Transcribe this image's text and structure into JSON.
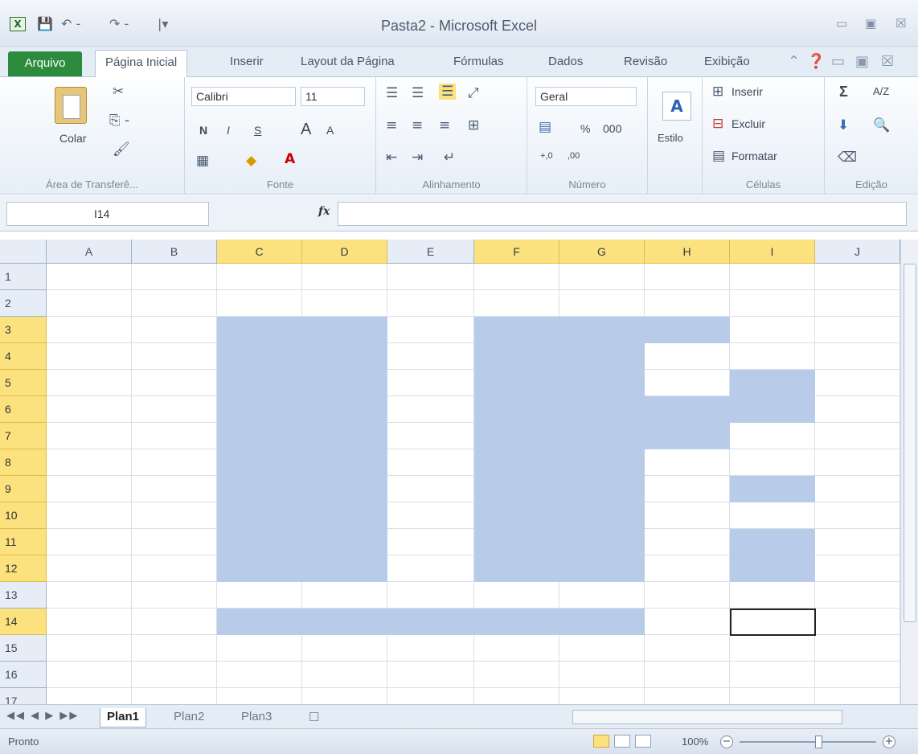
{
  "window": {
    "title": "Pasta2 - Microsoft Excel",
    "app_icon": "X",
    "qat": {
      "save": "save-icon",
      "undo": "↶ -",
      "redo": "↷ -",
      "customize": "|▾"
    },
    "controls": {
      "minimize": "▭",
      "restore": "▣",
      "close": "☒"
    }
  },
  "tabs": [
    {
      "label": "Arquivo"
    },
    {
      "label": "Página Inicial"
    },
    {
      "label": "Inserir"
    },
    {
      "label": "Layout da Página"
    },
    {
      "label": "Fórmulas"
    },
    {
      "label": "Dados"
    },
    {
      "label": "Revisão"
    },
    {
      "label": "Exibição"
    }
  ],
  "ribbon": {
    "clipboard": {
      "label": "Área de Transferê...",
      "paste": "Colar",
      "cut_icon": "✂",
      "copy_icon": "⎘ -",
      "format_icon": "🖌"
    },
    "font": {
      "label": "Fonte",
      "name": "Calibri",
      "size": "11",
      "bold": "N",
      "italic": "I",
      "underline": "S",
      "grow": "A",
      "shrink": "A"
    },
    "alignment": {
      "label": "Alinhamento"
    },
    "number": {
      "label": "Número",
      "format": "Geral",
      "percent": "%",
      "thousands": "000",
      "inc": "+,0",
      "dec": ",00"
    },
    "styles": {
      "label": "Estilo",
      "icon": "A"
    },
    "cells": {
      "label": "Células",
      "insert": "Inserir",
      "delete": "Excluir",
      "format": "Formatar"
    },
    "editing": {
      "label": "Edição",
      "sum": "Σ",
      "sort": "A/Z"
    }
  },
  "formula_bar": {
    "name_box": "I14",
    "fx": "fx",
    "formula": ""
  },
  "grid": {
    "columns": [
      "A",
      "B",
      "C",
      "D",
      "E",
      "F",
      "G",
      "H",
      "I",
      "J"
    ],
    "selected_columns": [
      "C",
      "D",
      "F",
      "G",
      "H",
      "I"
    ],
    "rows": [
      "1",
      "2",
      "3",
      "4",
      "5",
      "6",
      "7",
      "8",
      "9",
      "10",
      "11",
      "12",
      "13",
      "14",
      "15",
      "16",
      "17"
    ],
    "selected_rows": [
      "3",
      "4",
      "5",
      "6",
      "7",
      "8",
      "9",
      "10",
      "11",
      "12",
      "14"
    ],
    "selected_cells": [
      "C3",
      "C4",
      "C5",
      "C6",
      "C7",
      "C8",
      "C9",
      "C10",
      "C11",
      "C12",
      "D3",
      "D4",
      "D5",
      "D6",
      "D7",
      "D8",
      "D9",
      "D10",
      "D11",
      "D12",
      "F3",
      "F4",
      "F5",
      "F6",
      "F7",
      "F8",
      "F9",
      "F10",
      "F11",
      "F12",
      "G3",
      "G4",
      "G5",
      "G6",
      "G7",
      "G8",
      "G9",
      "G10",
      "G11",
      "G12",
      "H3",
      "H6",
      "H7",
      "I5",
      "I6",
      "I9",
      "I11",
      "I12",
      "C14",
      "D14",
      "E14",
      "F14",
      "G14"
    ],
    "active_cell": "I14"
  },
  "sheets": {
    "nav": "◀◀ ◀ ▶ ▶▶",
    "tabs": [
      "Plan1",
      "Plan2",
      "Plan3"
    ],
    "active": "Plan1",
    "new_sheet_icon": "☐"
  },
  "status": {
    "text": "Pronto",
    "zoom": "100%",
    "zoom_out": "−",
    "zoom_in": "+"
  }
}
